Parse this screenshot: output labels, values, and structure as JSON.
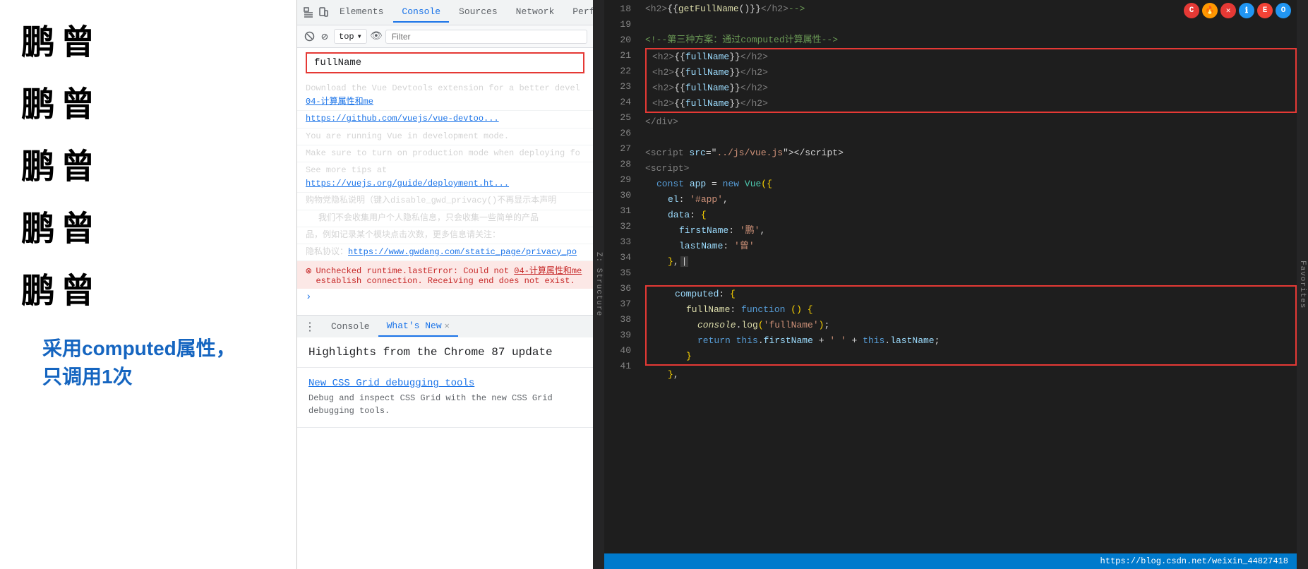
{
  "browser_page": {
    "chinese_rows": [
      {
        "chars": [
          "鹏",
          "曾"
        ]
      },
      {
        "chars": [
          "鹏",
          "曾"
        ]
      },
      {
        "chars": [
          "鹏",
          "曾"
        ]
      },
      {
        "chars": [
          "鹏",
          "曾"
        ]
      },
      {
        "chars": [
          "鹏",
          "曾"
        ]
      }
    ],
    "computed_label": "采用computed属性，只调用1次"
  },
  "devtools": {
    "tabs": [
      "Elements",
      "Console",
      "Sources",
      "Network",
      "Perfor..."
    ],
    "active_tab": "Console",
    "toolbar": {
      "context": "top",
      "filter_placeholder": "Filter"
    },
    "fullname_value": "fullName",
    "console_lines": [
      {
        "type": "link",
        "text": "04-计算属性和me",
        "prefix": "Download the Vue Devtools extension for a better devel"
      },
      {
        "type": "link_only",
        "text": "https://github.com/vuejs/vue-devtoo..."
      },
      {
        "type": "text",
        "text": "You are running Vue in development mode."
      },
      {
        "type": "text",
        "text": "Make sure to turn on production mode when deploying fo"
      },
      {
        "type": "link",
        "text": "https://vuejs.org/guide/deployment.ht",
        "prefix": "See more tips at "
      },
      {
        "type": "text",
        "text": "购物党隐私说明（键入disable_gwd_privacy()不再显示本声明"
      },
      {
        "type": "text",
        "text": "  我们不会收集用户个人隐私信息，只会收集一些简单的产品"
      },
      {
        "type": "text",
        "text": "品，例如记录某个模块点击次数，更多信息请关注："
      },
      {
        "type": "link",
        "text": "https://www.gwdang.com/static_page/privacy_po",
        "prefix": "隐私协议："
      }
    ],
    "error_line": {
      "text": "Unchecked runtime.lastError: Could not",
      "link": "04-计算属性和me",
      "text2": "establish connection. Receiving end does not exist."
    },
    "bottom_tabs": [
      "Console",
      "What's New"
    ],
    "active_bottom_tab": "What's New",
    "whatsnew": {
      "header": "Highlights from the Chrome 87 update",
      "items": [
        {
          "title": "New CSS Grid debugging tools",
          "desc": "Debug and inspect CSS Grid with the new CSS Grid debugging tools."
        }
      ]
    }
  },
  "code_editor": {
    "lines": [
      {
        "num": 18,
        "content": "  <h2>{{getFullName()}}</h2>-->"
      },
      {
        "num": 19,
        "content": ""
      },
      {
        "num": 20,
        "content": "  <!--第三种方案：通过computed计算属性-->"
      },
      {
        "num": 21,
        "content": "  <h2>{{fullName}}</h2>",
        "box": true
      },
      {
        "num": 22,
        "content": "  <h2>{{fullName}}</h2>",
        "box": true
      },
      {
        "num": 23,
        "content": "  <h2>{{fullName}}</h2>",
        "box": true
      },
      {
        "num": 24,
        "content": "  <h2>{{fullName}}</h2>",
        "box": true
      },
      {
        "num": 25,
        "content": "  </div>"
      },
      {
        "num": 26,
        "content": ""
      },
      {
        "num": 27,
        "content": "  <script src=\"../js/vue.js\"><\\/script>"
      },
      {
        "num": 28,
        "content": "  <script>"
      },
      {
        "num": 29,
        "content": "    const app = new Vue({"
      },
      {
        "num": 30,
        "content": "      el: '#app',"
      },
      {
        "num": 31,
        "content": "      data: {"
      },
      {
        "num": 32,
        "content": "        firstName: '鹏',"
      },
      {
        "num": 33,
        "content": "        lastName: '曾'"
      },
      {
        "num": 34,
        "content": "      },"
      },
      {
        "num": 35,
        "content": ""
      },
      {
        "num": 36,
        "content": "      computed: {",
        "computed_box_start": true
      },
      {
        "num": 37,
        "content": "        fullName: function () {"
      },
      {
        "num": 38,
        "content": "          console.log('fullName');"
      },
      {
        "num": 39,
        "content": "          return this.firstName + ' ' + this.lastName;"
      },
      {
        "num": 40,
        "content": "        }",
        "computed_box_end": true
      },
      {
        "num": 41,
        "content": "      },"
      }
    ],
    "status_bar": {
      "url": "https://blog.csdn.net/weixin_44827418"
    }
  },
  "chrome_icons": {
    "colors": [
      "#e53935",
      "#ff9800",
      "#e53935",
      "#2196f3",
      "#f44336",
      "#2196f3"
    ]
  },
  "sidebar_labels": [
    "Z: Structure",
    "Favorites"
  ]
}
